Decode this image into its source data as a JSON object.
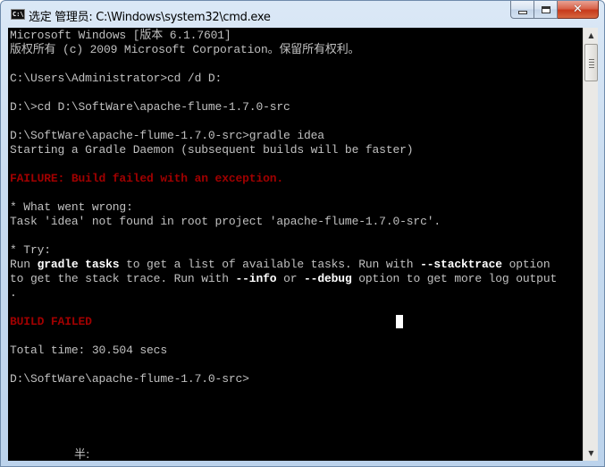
{
  "window": {
    "title": "选定 管理员: C:\\Windows\\system32\\cmd.exe",
    "icon": "cmd-icon",
    "icon_label": "C:\\",
    "buttons": {
      "minimize": "minimize-icon",
      "maximize": "maximize-icon",
      "close_label": "✕"
    }
  },
  "console": {
    "lines": [
      {
        "segments": [
          {
            "text": "Microsoft Windows [版本 6.1.7601]",
            "style": "normal"
          }
        ]
      },
      {
        "segments": [
          {
            "text": "版权所有 (c) 2009 Microsoft Corporation。保留所有权利。",
            "style": "normal"
          }
        ]
      },
      {
        "segments": [
          {
            "text": "",
            "style": "normal"
          }
        ]
      },
      {
        "segments": [
          {
            "text": "C:\\Users\\Administrator>cd /d D:",
            "style": "normal"
          }
        ]
      },
      {
        "segments": [
          {
            "text": "",
            "style": "normal"
          }
        ]
      },
      {
        "segments": [
          {
            "text": "D:\\>cd D:\\SoftWare\\apache-flume-1.7.0-src",
            "style": "normal"
          }
        ]
      },
      {
        "segments": [
          {
            "text": "",
            "style": "normal"
          }
        ]
      },
      {
        "segments": [
          {
            "text": "D:\\SoftWare\\apache-flume-1.7.0-src>gradle idea",
            "style": "normal"
          }
        ]
      },
      {
        "segments": [
          {
            "text": "Starting a Gradle Daemon (subsequent builds will be faster)",
            "style": "normal"
          }
        ]
      },
      {
        "segments": [
          {
            "text": "",
            "style": "normal"
          }
        ]
      },
      {
        "segments": [
          {
            "text": "FAILURE: Build failed with an exception.",
            "style": "red"
          }
        ]
      },
      {
        "segments": [
          {
            "text": "",
            "style": "normal"
          }
        ]
      },
      {
        "segments": [
          {
            "text": "* What went wrong:",
            "style": "normal"
          }
        ]
      },
      {
        "segments": [
          {
            "text": "Task 'idea' not found in root project 'apache-flume-1.7.0-src'.",
            "style": "normal"
          }
        ]
      },
      {
        "segments": [
          {
            "text": "",
            "style": "normal"
          }
        ]
      },
      {
        "segments": [
          {
            "text": "* Try:",
            "style": "normal"
          }
        ]
      },
      {
        "segments": [
          {
            "text": "Run ",
            "style": "normal"
          },
          {
            "text": "gradle tasks",
            "style": "bold"
          },
          {
            "text": " to get a list of available tasks. Run with ",
            "style": "normal"
          },
          {
            "text": "--stacktrace",
            "style": "bold"
          },
          {
            "text": " option",
            "style": "normal"
          }
        ]
      },
      {
        "segments": [
          {
            "text": "to get the stack trace. Run with ",
            "style": "normal"
          },
          {
            "text": "--info",
            "style": "bold"
          },
          {
            "text": " or ",
            "style": "normal"
          },
          {
            "text": "--debug",
            "style": "bold"
          },
          {
            "text": " option to get more log output",
            "style": "normal"
          }
        ]
      },
      {
        "segments": [
          {
            "text": ".",
            "style": "normal"
          }
        ]
      },
      {
        "segments": [
          {
            "text": "",
            "style": "normal"
          }
        ]
      },
      {
        "segments": [
          {
            "text": "BUILD FAILED",
            "style": "red"
          }
        ]
      },
      {
        "segments": [
          {
            "text": "",
            "style": "normal"
          }
        ]
      },
      {
        "segments": [
          {
            "text": "Total time: 30.504 secs",
            "style": "normal"
          }
        ]
      },
      {
        "segments": [
          {
            "text": "",
            "style": "normal"
          }
        ]
      },
      {
        "segments": [
          {
            "text": "D:\\SoftWare\\apache-flume-1.7.0-src>",
            "style": "normal"
          }
        ]
      }
    ],
    "ime_status": "半:"
  },
  "scrollbar": {
    "up_arrow": "▲",
    "down_arrow": "▼"
  }
}
